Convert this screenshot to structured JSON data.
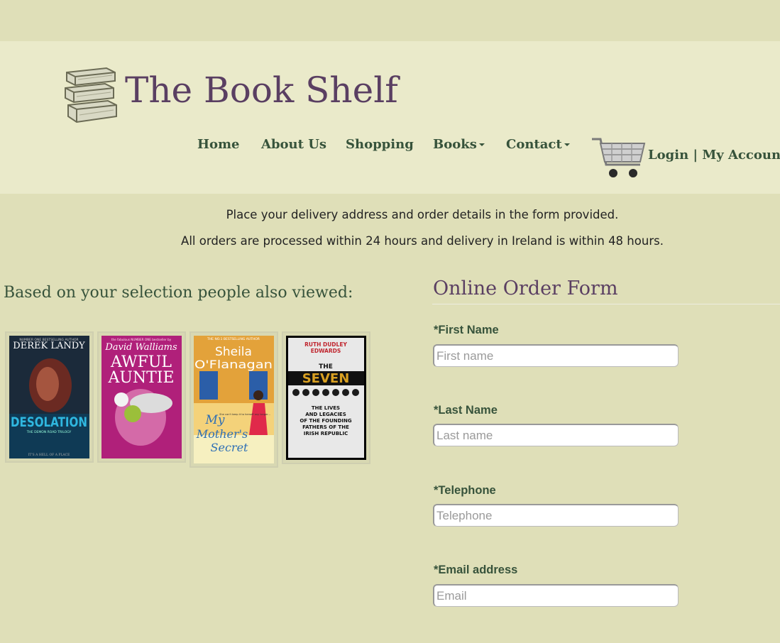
{
  "site": {
    "title": "The Book Shelf"
  },
  "nav": {
    "items": [
      {
        "label": "Home"
      },
      {
        "label": "About Us"
      },
      {
        "label": "Shopping"
      },
      {
        "label": "Books",
        "dropdown": true
      },
      {
        "label": "Contact",
        "dropdown": true
      }
    ]
  },
  "account": {
    "login": "Login",
    "separator": "|",
    "my_account": "My Account"
  },
  "info": {
    "line1": "Place your delivery address and order details in the form provided.",
    "line2": "All orders are processed within 24 hours and delivery in Ireland is within 48 hours."
  },
  "viewed": {
    "heading": "Based on your selection people also viewed:",
    "books": [
      {
        "author": "DEREK LANDY",
        "tagline": "NUMBER ONE BESTSELLING AUTHOR",
        "title": "DESOLATION",
        "series": "THE DEMON ROAD TRILOGY",
        "footer": "IT'S A HELL OF A PLACE"
      },
      {
        "author": "David Walliams",
        "tagline": "the fabulous NUMBER ONE bestseller by",
        "title_line1": "AWFUL",
        "title_line2": "AUNTIE",
        "badge": "WINNER of the National Book Award"
      },
      {
        "author_line1": "Sheila",
        "author_line2": "O'Flanagan",
        "tagline": "THE NO.1 BESTSELLING AUTHOR",
        "title_line1": "My",
        "title_line2": "Mother's",
        "title_line3": "Secret",
        "blurb": "She can't keep it to herself any longer..."
      },
      {
        "author_line1": "RUTH DUDLEY",
        "author_line2": "EDWARDS",
        "title_line1": "THE",
        "title_line2": "SEVEN",
        "subtitle_line1": "THE LIVES",
        "subtitle_line2": "AND LEGACIES",
        "subtitle_line3": "OF THE FOUNDING",
        "subtitle_line4": "FATHERS OF THE",
        "subtitle_line5": "IRISH REPUBLIC"
      }
    ]
  },
  "form": {
    "title": "Online Order Form",
    "fields": [
      {
        "label": "*First Name",
        "placeholder": "First name",
        "value": ""
      },
      {
        "label": "*Last Name",
        "placeholder": "Last name",
        "value": ""
      },
      {
        "label": "*Telephone",
        "placeholder": "Telephone",
        "value": ""
      },
      {
        "label": "*Email address",
        "placeholder": "Email",
        "value": ""
      }
    ]
  },
  "colors": {
    "page_bg": "#dfdfb8",
    "header_bg": "#eaeaca",
    "title": "#5a3f62",
    "nav": "#37533b"
  }
}
